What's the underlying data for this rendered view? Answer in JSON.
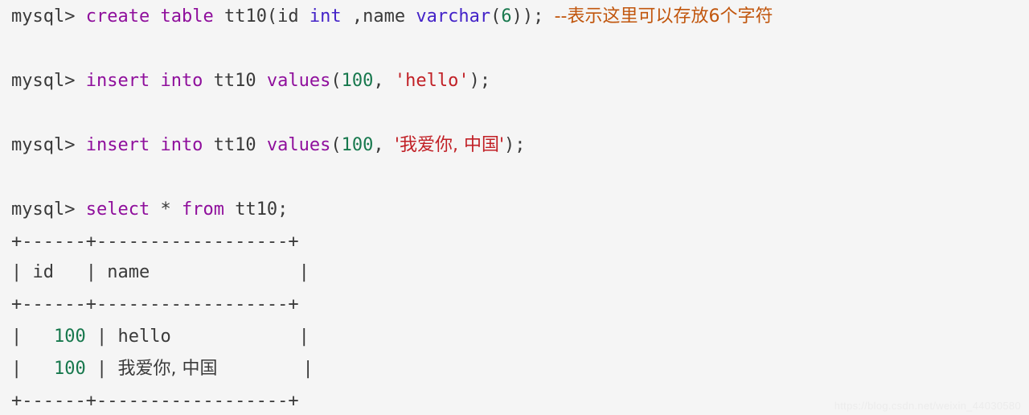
{
  "terminal": {
    "background_color": "#f5f5f5",
    "prompt": "mysql>",
    "commands": [
      {
        "id": "create-table",
        "prompt": "mysql>",
        "keyword_create": "create",
        "keyword_table": "table",
        "table_name": "tt10(id",
        "type_int": "int",
        "column_name": " ,name ",
        "type_varchar": "varchar",
        "paren_open": "(",
        "length": "6",
        "paren_close": "));",
        "comment": "--表示这里可以存放6个字符"
      },
      {
        "id": "insert-hello",
        "prompt": "mysql>",
        "keyword_insert": "insert into",
        "table_name": " tt10 ",
        "keyword_values": "values",
        "paren_open": "(",
        "value_id": "100",
        "separator": ", ",
        "value_name": "'hello'",
        "paren_close": ");"
      },
      {
        "id": "insert-chinese",
        "prompt": "mysql>",
        "keyword_insert": "insert into",
        "table_name": " tt10 ",
        "keyword_values": "values",
        "paren_open": "(",
        "value_id": "100",
        "separator": ", ",
        "value_name": "'我爱你, 中国'",
        "paren_close": ");"
      },
      {
        "id": "select-all",
        "prompt": "mysql>",
        "keyword_select": "select",
        "star": " * ",
        "keyword_from": "from",
        "table_name": " tt10;"
      }
    ],
    "result_table": {
      "border_top": "+------+------------------+",
      "header_row_prefix": "| ",
      "header_id": "id",
      "header_id_pad": "   | ",
      "header_name": "name",
      "header_name_pad": "              |",
      "border_mid": "+------+------------------+",
      "rows": [
        {
          "prefix": "|   ",
          "id": "100",
          "mid": " | ",
          "name": "hello",
          "pad": "            |"
        },
        {
          "prefix": "|   ",
          "id": "100",
          "mid": " | ",
          "name": "我爱你, 中国",
          "pad": "        |"
        }
      ],
      "border_bottom": "+------+------------------+"
    },
    "colors": {
      "keyword": "#8f0f9c",
      "type": "#4423c8",
      "number": "#17784d",
      "string": "#c12026",
      "comment": "#c1560d",
      "text": "#3a3a3a"
    }
  },
  "watermark": {
    "text": "https://blog.csdn.net/weixin_44030580"
  }
}
